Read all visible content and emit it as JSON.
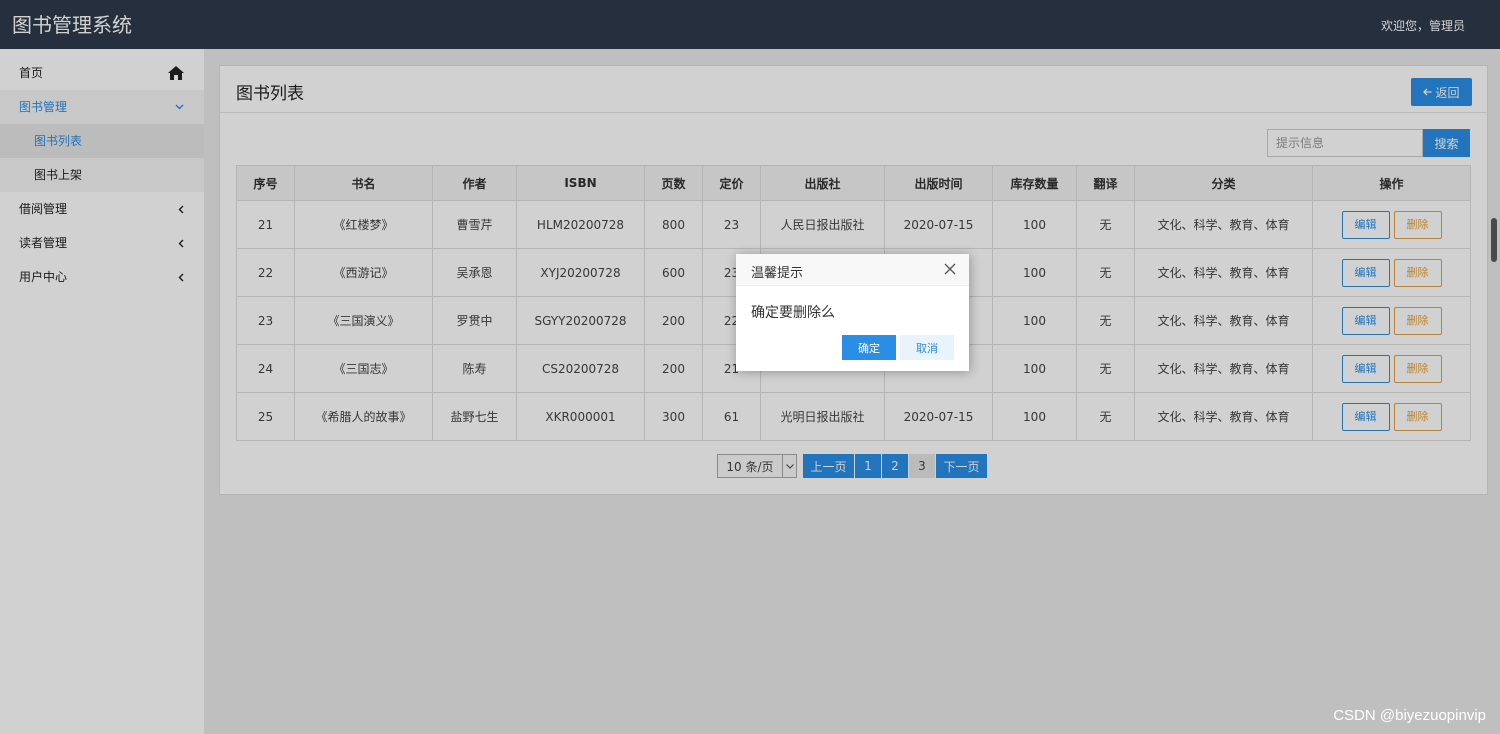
{
  "header": {
    "app_title": "图书管理系统",
    "welcome": "欢迎您，管理员"
  },
  "sidebar": {
    "home": "首页",
    "book_mgmt": "图书管理",
    "book_list": "图书列表",
    "book_add": "图书上架",
    "borrow_mgmt": "借阅管理",
    "reader_mgmt": "读者管理",
    "user_center": "用户中心"
  },
  "panel": {
    "title": "图书列表",
    "back_label": "返回"
  },
  "search": {
    "placeholder": "提示信息",
    "button": "搜索"
  },
  "table": {
    "headers": [
      "序号",
      "书名",
      "作者",
      "ISBN",
      "页数",
      "定价",
      "出版社",
      "出版时间",
      "库存数量",
      "翻译",
      "分类",
      "操作"
    ],
    "rows": [
      {
        "id": "21",
        "title": "《红楼梦》",
        "author": "曹雪芹",
        "isbn": "HLM20200728",
        "pages": "800",
        "price": "23",
        "publisher": "人民日报出版社",
        "pub_date": "2020-07-15",
        "stock": "100",
        "translated": "无",
        "category": "文化、科学、教育、体育"
      },
      {
        "id": "22",
        "title": "《西游记》",
        "author": "吴承恩",
        "isbn": "XYJ20200728",
        "pages": "600",
        "price": "23",
        "publisher": "",
        "pub_date": "",
        "stock": "100",
        "translated": "无",
        "category": "文化、科学、教育、体育"
      },
      {
        "id": "23",
        "title": "《三国演义》",
        "author": "罗贯中",
        "isbn": "SGYY20200728",
        "pages": "200",
        "price": "22",
        "publisher": "",
        "pub_date": "",
        "stock": "100",
        "translated": "无",
        "category": "文化、科学、教育、体育"
      },
      {
        "id": "24",
        "title": "《三国志》",
        "author": "陈寿",
        "isbn": "CS20200728",
        "pages": "200",
        "price": "21",
        "publisher": "",
        "pub_date": "",
        "stock": "100",
        "translated": "无",
        "category": "文化、科学、教育、体育"
      },
      {
        "id": "25",
        "title": "《希腊人的故事》",
        "author": "盐野七生",
        "isbn": "XKR000001",
        "pages": "300",
        "price": "61",
        "publisher": "光明日报出版社",
        "pub_date": "2020-07-15",
        "stock": "100",
        "translated": "无",
        "category": "文化、科学、教育、体育"
      }
    ],
    "edit_label": "编辑",
    "delete_label": "删除"
  },
  "pager": {
    "page_size": "10 条/页",
    "prev": "上一页",
    "pages": [
      "1",
      "2",
      "3"
    ],
    "current_page": "3",
    "next": "下一页"
  },
  "dialog": {
    "title": "温馨提示",
    "message": "确定要删除么",
    "ok": "确定",
    "cancel": "取消"
  },
  "watermark": "CSDN @biyezuopinvip",
  "colors": {
    "accent": "#2a8ee6",
    "topbar": "#2f3a4b",
    "delete": "#e6a23c"
  }
}
